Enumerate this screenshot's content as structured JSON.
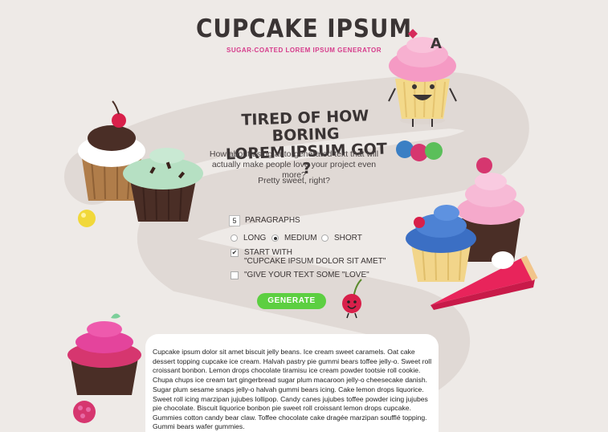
{
  "header": {
    "title": "CUPCAKE IPSUM",
    "subtitle": "SUGAR-COATED LOREM IPSUM GENERATOR"
  },
  "intro": {
    "headline_line1": "TIRED OF HOW BORING",
    "headline_line2": "LOREM IPSUM GOT ?",
    "body": "How about using auto-generated text that will actually make people love your project even more?",
    "tagline": "Pretty sweet, right?"
  },
  "form": {
    "paragraph_count": "5",
    "paragraphs_label": "PARAGRAPHS",
    "lengths": [
      {
        "label": "LONG",
        "selected": false
      },
      {
        "label": "MEDIUM",
        "selected": true
      },
      {
        "label": "SHORT",
        "selected": false
      }
    ],
    "start_with_checked": "✔",
    "start_with_label_line1": "START WITH",
    "start_with_label_line2": "\"CUPCAKE IPSUM DOLOR SIT AMET\"",
    "love_label": "\"GIVE YOUR TEXT SOME \"LOVE\"",
    "generate_label": "GENERATE"
  },
  "mascot_letter": "A",
  "output": {
    "paragraphs": [
      "Cupcake ipsum dolor sit amet biscuit jelly beans. Ice cream sweet caramels. Oat cake dessert topping cupcake ice cream. Halvah pastry pie gummi bears toffee jelly-o. Sweet roll croissant bonbon. Lemon drops chocolate tiramisu ice cream powder tootsie roll cookie. Chupa chups ice cream tart gingerbread sugar plum macaroon jelly-o cheesecake danish.",
      "Sugar plum sesame snaps jelly-o halvah gummi bears icing. Cake lemon drops liquorice. Sweet roll icing marzipan jujubes lollipop. Candy canes jujubes toffee powder icing jujubes pie chocolate. Biscuit liquorice bonbon pie sweet roll croissant lemon drops cupcake. Gummies cotton candy bear claw. Toffee chocolate cake dragée marzipan soufflé topping. Gummi bears wafer gummies."
    ]
  },
  "colors": {
    "accent": "#d63b8b",
    "button": "#5ccf41",
    "text": "#3a3434",
    "background": "#eeeae7"
  },
  "icons": [
    "cupcake-mascot-illustration",
    "cherry-cupcake-illustration",
    "mint-cupcake-illustration",
    "candy-balls-illustration",
    "pink-cupcake-illustration",
    "blue-cupcake-illustration",
    "pie-slice-illustration",
    "cherry-mascot-illustration",
    "raspberry-illustration",
    "yellow-candy-illustration"
  ]
}
